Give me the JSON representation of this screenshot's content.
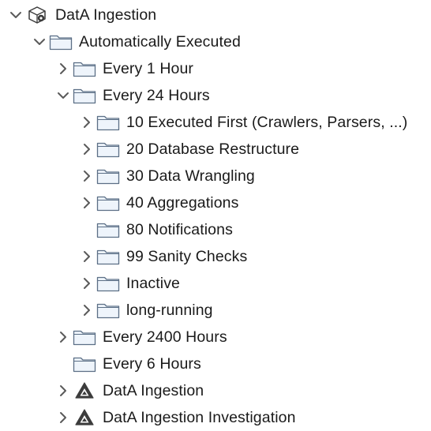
{
  "tree": {
    "items": [
      {
        "label": "DatA Ingestion",
        "icon": "project-icon",
        "level": 0,
        "state": "expanded"
      },
      {
        "label": "Automatically Executed",
        "icon": "folder-icon",
        "level": 1,
        "state": "expanded"
      },
      {
        "label": "Every 1 Hour",
        "icon": "folder-icon",
        "level": 2,
        "state": "collapsed"
      },
      {
        "label": "Every 24 Hours",
        "icon": "folder-icon",
        "level": 2,
        "state": "expanded"
      },
      {
        "label": "10 Executed First (Crawlers, Parsers, ...)",
        "icon": "folder-icon",
        "level": 3,
        "state": "collapsed"
      },
      {
        "label": "20 Database Restructure",
        "icon": "folder-icon",
        "level": 3,
        "state": "collapsed"
      },
      {
        "label": "30 Data Wrangling",
        "icon": "folder-icon",
        "level": 3,
        "state": "collapsed"
      },
      {
        "label": "40 Aggregations",
        "icon": "folder-icon",
        "level": 3,
        "state": "collapsed"
      },
      {
        "label": "80 Notifications",
        "icon": "folder-icon",
        "level": 3,
        "state": "leaf"
      },
      {
        "label": "99 Sanity Checks",
        "icon": "folder-icon",
        "level": 3,
        "state": "collapsed"
      },
      {
        "label": "Inactive",
        "icon": "folder-icon",
        "level": 3,
        "state": "collapsed"
      },
      {
        "label": "long-running",
        "icon": "folder-icon",
        "level": 3,
        "state": "collapsed"
      },
      {
        "label": "Every 2400 Hours",
        "icon": "folder-icon",
        "level": 2,
        "state": "collapsed"
      },
      {
        "label": "Every 6 Hours",
        "icon": "folder-icon",
        "level": 2,
        "state": "leaf"
      },
      {
        "label": "DatA Ingestion",
        "icon": "linked-project-icon",
        "level": 2,
        "state": "collapsed"
      },
      {
        "label": "DatA Ingestion Investigation",
        "icon": "linked-project-icon",
        "level": 2,
        "state": "collapsed"
      }
    ]
  },
  "colors": {
    "text": "#1a1a1a",
    "chevron": "#5a5a5a",
    "folder_fill": "#eef4fb",
    "folder_stroke": "#5c6f86",
    "icon_dark": "#3c3c3c"
  }
}
